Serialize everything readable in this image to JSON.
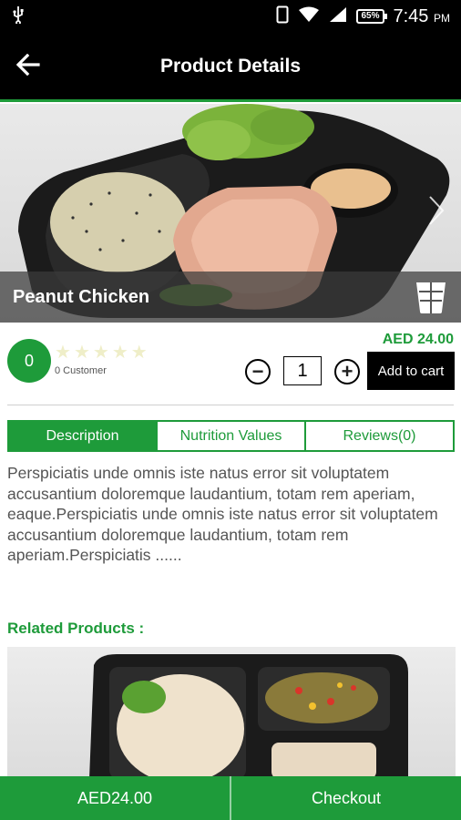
{
  "status_bar": {
    "battery": "65%",
    "time": "7:45",
    "ampm": "PM"
  },
  "app_bar": {
    "title": "Product Details"
  },
  "product": {
    "name": "Peanut Chicken",
    "price": "AED 24.00",
    "rating": "0",
    "stars_filled": 0,
    "stars_total": 5,
    "customer_count": "0 Customer",
    "quantity": "1"
  },
  "actions": {
    "add_to_cart": "Add to cart",
    "qty_minus_symbol": "−",
    "qty_plus_symbol": "+"
  },
  "tabs": [
    {
      "label": "Description",
      "active": true
    },
    {
      "label": "Nutrition Values",
      "active": false
    },
    {
      "label": "Reviews(0)",
      "active": false
    }
  ],
  "description": "Perspiciatis unde omnis iste natus error sit voluptatem accusantium doloremque laudantium, totam rem aperiam, eaque.Perspiciatis unde omnis iste natus error sit voluptatem accusantium doloremque laudantium, totam rem aperiam.Perspiciatis ......",
  "related": {
    "title": "Related Products :"
  },
  "bottom_bar": {
    "total": "AED24.00",
    "checkout": "Checkout"
  },
  "colors": {
    "accent": "#1e9b3a",
    "bar": "#000000"
  },
  "icons": {
    "back": "arrow-left-icon",
    "category": "meal-box-icon",
    "next": "chevron-right-icon"
  }
}
